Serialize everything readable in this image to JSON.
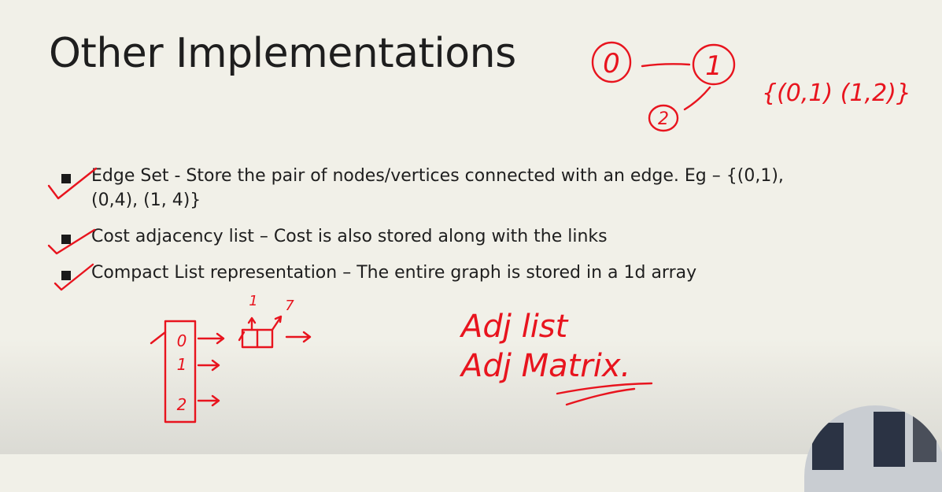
{
  "slide": {
    "title": "Other Implementations",
    "bullets": [
      {
        "text": "Edge Set - Store the pair of nodes/vertices connected with an edge. Eg – {(0,1), (0,4), (1, 4)}"
      },
      {
        "text": "Cost adjacency list – Cost is also stored along with the links"
      },
      {
        "text": "Compact List representation – The entire graph is stored in a 1d array"
      }
    ]
  },
  "annotations": {
    "graph_nodes": [
      "0",
      "1",
      "2"
    ],
    "edge_set": "{(0,1)  (1,2)}",
    "array_cells": [
      "0",
      "1",
      "2"
    ],
    "list_values": [
      "1",
      "7"
    ],
    "notes": [
      "Adj list",
      "Adj Matrix."
    ]
  },
  "colors": {
    "ink": "#e8141e",
    "background": "#f1f0e8",
    "text": "#1e1e1e"
  }
}
